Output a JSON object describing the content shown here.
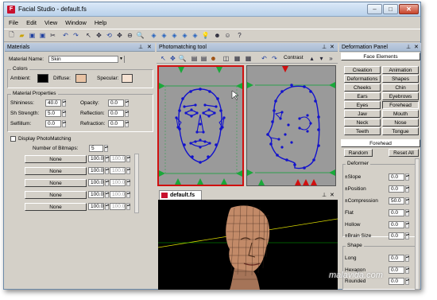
{
  "window": {
    "title": "Facial Studio - default.fs",
    "app_icon_letter": "F"
  },
  "menu": [
    "File",
    "Edit",
    "View",
    "Window",
    "Help"
  ],
  "materials": {
    "header": "Materials",
    "material_name_label": "Material Name:",
    "material_name_value": "Skin",
    "colors_title": "Colors",
    "ambient_label": "Ambient:",
    "diffuse_label": "Diffuse:",
    "specular_label": "Specular:",
    "ambient_color": "#000000",
    "diffuse_color": "#e9c3a4",
    "specular_color": "#f6e2d2",
    "props_title": "Material Properties",
    "shininess_label": "Shininess:",
    "shininess_value": "40.0",
    "sh_strength_label": "Sh Strength:",
    "sh_strength_value": "5.0",
    "selfillum_label": "Selfillum:",
    "selfillum_value": "0.0",
    "opacity_label": "Opacity:",
    "opacity_value": "0.0",
    "reflection_label": "Reflection:",
    "reflection_value": "0.0",
    "refraction_label": "Refraction:",
    "refraction_value": "0.0",
    "display_photomatching_label": "Display PhotoMatching",
    "num_bitmaps_label": "Number of Bitmaps:",
    "num_bitmaps_value": "5",
    "bitmaps": [
      {
        "name": "None",
        "v1": "100.0",
        "v2": "100.0"
      },
      {
        "name": "None",
        "v1": "100.0",
        "v2": "100.0"
      },
      {
        "name": "None",
        "v1": "100.0",
        "v2": "100.0"
      },
      {
        "name": "None",
        "v1": "100.0",
        "v2": "100.0"
      },
      {
        "name": "None",
        "v1": "100.0",
        "v2": "100.0"
      }
    ]
  },
  "photomatch": {
    "header": "Photomatching tool",
    "contrast_label": "Contrast"
  },
  "view3d": {
    "tab_label": "default.fs"
  },
  "deformation": {
    "header": "Deformation Panel",
    "face_elements_label": "Face Elements",
    "buttons": [
      [
        "Creation",
        "Animation"
      ],
      [
        "Deformations",
        "Shapes"
      ],
      [
        "Cheeks",
        "Chin"
      ],
      [
        "Ears",
        "Eyebrows"
      ],
      [
        "Eyes",
        "Forehead"
      ],
      [
        "Jaw",
        "Mouth"
      ],
      [
        "Neck",
        "Nose"
      ],
      [
        "Teeth",
        "Tongue"
      ]
    ],
    "current_element": "Forehead",
    "random_label": "Random",
    "reset_all_label": "Reset All",
    "deformer_title": "Deformer",
    "deformer_rows": [
      {
        "label": "±Slope",
        "value": "0.0"
      },
      {
        "label": "±Position",
        "value": "0.0"
      },
      {
        "label": "±Compression",
        "value": "50.0"
      },
      {
        "label": "Flat",
        "value": "0.0"
      },
      {
        "label": "Hollow",
        "value": "0.0"
      },
      {
        "label": "±Brain Size",
        "value": "0.0"
      }
    ],
    "shape_title": "Shape",
    "shape_rows": [
      {
        "label": "Long",
        "value": "0.0"
      },
      {
        "label": "Hexagon",
        "value": "0.0"
      },
      {
        "label": "Rounded",
        "value": "0.0"
      }
    ]
  },
  "watermark": "malavida.com",
  "icons": [
    "save-icon",
    "undo-icon",
    "redo-icon",
    "select-icon",
    "zoom-icon",
    "pin-icon",
    "close-icon"
  ]
}
